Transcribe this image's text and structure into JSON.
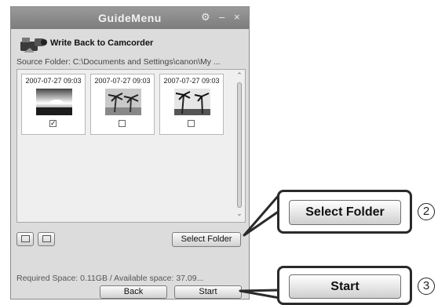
{
  "window": {
    "title": "GuideMenu",
    "controls": {
      "tools": "⚙",
      "minimize": "–",
      "close": "×"
    },
    "header_label": "Write Back to Camcorder",
    "source_folder": "Source Folder: C:\\Documents and Settings\\canon\\My ...",
    "thumbnails": [
      {
        "date": "2007-07-27 09:03",
        "checked": "✓",
        "scene": "sunset"
      },
      {
        "date": "2007-07-27 09:03",
        "checked": "",
        "scene": "palms"
      },
      {
        "date": "2007-07-27 09:03",
        "checked": "",
        "scene": "palms-sky"
      }
    ],
    "select_folder_label": "Select Folder",
    "required_space": "Required Space: 0.11GB / Available space: 37.09...",
    "back_label": "Back",
    "start_label": "Start"
  },
  "callouts": [
    {
      "number": "2",
      "label": "Select Folder"
    },
    {
      "number": "3",
      "label": "Start"
    }
  ],
  "colors": {
    "titlebar": "#8a8a8a",
    "window_bg": "#dcdcdc",
    "callout_border": "#2a2a2a"
  }
}
